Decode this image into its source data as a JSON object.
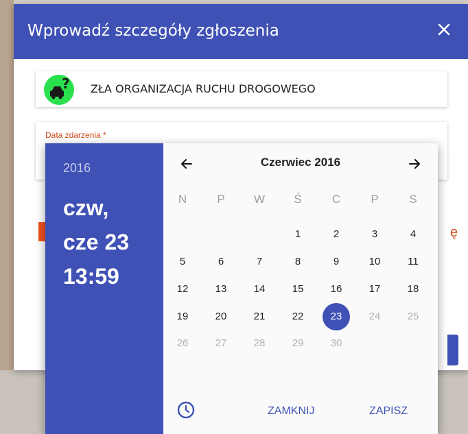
{
  "dialog": {
    "title": "Wprowadź szczegóły zgłoszenia",
    "close_icon": "close-icon",
    "category_label": "ZŁA ORGANIZACJA RUCHU DROGOWEGO",
    "category_icon": "car-question-icon",
    "date_field_label": "Data zdarzenia *",
    "partial_text_right": "ę"
  },
  "picker": {
    "year": "2016",
    "weekday_line": "czw,",
    "date_line": "cze 23",
    "time_line": "13:59",
    "month_title": "Czerwiec 2016",
    "prev_icon": "arrow-left-icon",
    "next_icon": "arrow-right-icon",
    "weekdays": [
      "N",
      "P",
      "W",
      "Ś",
      "C",
      "P",
      "S"
    ],
    "weeks": [
      [
        "",
        "",
        "",
        "1",
        "2",
        "3",
        "4"
      ],
      [
        "5",
        "6",
        "7",
        "8",
        "9",
        "10",
        "11"
      ],
      [
        "12",
        "13",
        "14",
        "15",
        "16",
        "17",
        "18"
      ],
      [
        "19",
        "20",
        "21",
        "22",
        "23",
        "24",
        "25"
      ],
      [
        "26",
        "27",
        "28",
        "29",
        "30",
        "",
        ""
      ]
    ],
    "selected_day": "23",
    "disabled_days": [
      "24",
      "25",
      "26",
      "27",
      "28",
      "29",
      "30"
    ],
    "clock_icon": "clock-icon",
    "close_label": "ZAMKNIJ",
    "save_label": "ZAPISZ"
  },
  "colors": {
    "primary": "#3f51b5",
    "accent": "#f4511e",
    "category_icon_bg": "#2be04f"
  }
}
